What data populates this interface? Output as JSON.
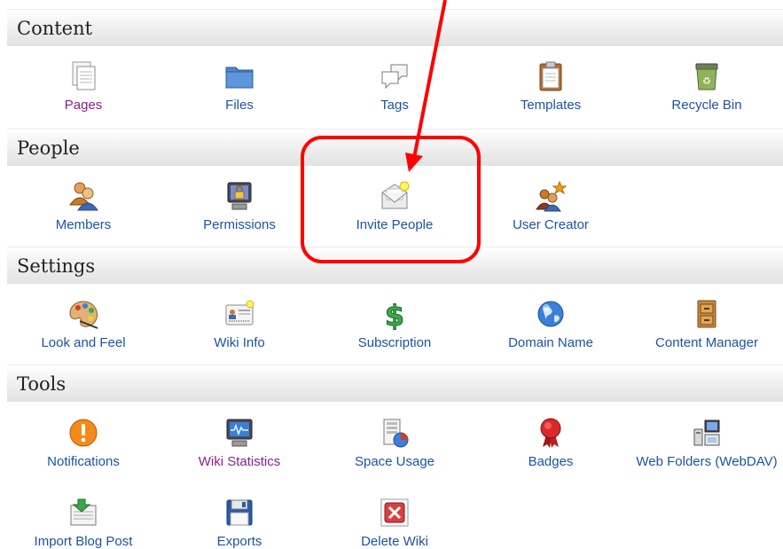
{
  "sections": {
    "content": {
      "title": "Content",
      "items": [
        "Pages",
        "Files",
        "Tags",
        "Templates",
        "Recycle Bin"
      ]
    },
    "people": {
      "title": "People",
      "items": [
        "Members",
        "Permissions",
        "Invite People",
        "User Creator"
      ]
    },
    "settings": {
      "title": "Settings",
      "items": [
        "Look and Feel",
        "Wiki Info",
        "Subscription",
        "Domain Name",
        "Content Manager"
      ]
    },
    "tools": {
      "title": "Tools",
      "items": [
        "Notifications",
        "Wiki Statistics",
        "Space Usage",
        "Badges",
        "Web Folders (WebDAV)",
        "Import Blog Post",
        "Exports",
        "Delete Wiki"
      ]
    }
  },
  "colors": {
    "link": "#1d52a6",
    "visited_link": "#8a1f8f",
    "annotation": "#ff0000"
  },
  "annotation": {
    "highlighted_item": "Invite People",
    "shape": "rounded-rectangle with arrow"
  }
}
